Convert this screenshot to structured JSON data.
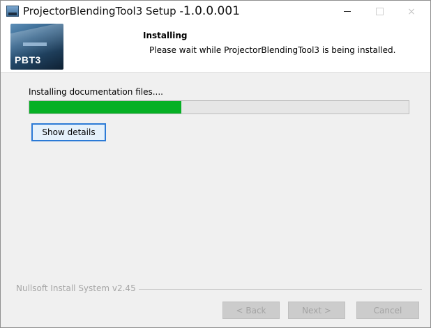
{
  "window": {
    "title": "ProjectorBlendingTool3 Setup -",
    "version": "1.0.0.001",
    "controls": {
      "close_glyph": "×"
    }
  },
  "header": {
    "logo_text": "PBT3",
    "title": "Installing",
    "subtitle": "Please wait while ProjectorBlendingTool3 is being installed."
  },
  "main": {
    "status_text": "Installing documentation files....",
    "progress_fraction": 0.4,
    "show_details_label": "Show details"
  },
  "footer": {
    "brand_text": "Nullsoft Install System v2.45",
    "back_label": "< Back",
    "next_label": "Next >",
    "cancel_label": "Cancel"
  },
  "colors": {
    "progress_fill": "#06b025",
    "focus_border": "#2b7ad6"
  }
}
